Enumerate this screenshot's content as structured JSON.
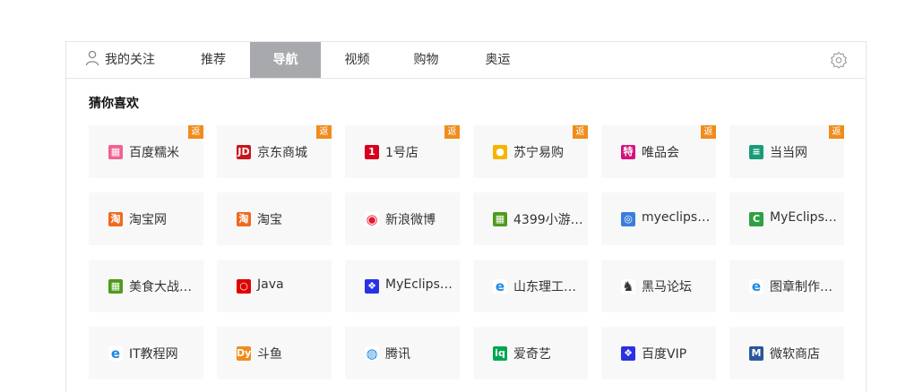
{
  "tabs": [
    {
      "label": "我的关注",
      "active": false
    },
    {
      "label": "推荐",
      "active": false
    },
    {
      "label": "导航",
      "active": true
    },
    {
      "label": "视频",
      "active": false
    },
    {
      "label": "购物",
      "active": false
    },
    {
      "label": "奥运",
      "active": false
    }
  ],
  "section_title": "猜你喜欢",
  "badge_label": "返",
  "colors": {
    "active_tab": "#a7a9ac",
    "badge": "#f08c1e",
    "tile_bg": "#f8f8f8"
  },
  "sites": [
    [
      {
        "label": "百度糯米",
        "icon": "nuomi-icon",
        "badge": true
      },
      {
        "label": "京东商城",
        "icon": "jd-icon",
        "badge": true
      },
      {
        "label": "1号店",
        "icon": "yhd-icon",
        "badge": true
      },
      {
        "label": "苏宁易购",
        "icon": "suning-icon",
        "badge": true
      },
      {
        "label": "唯品会",
        "icon": "vip-icon",
        "badge": true
      },
      {
        "label": "当当网",
        "icon": "dangdang-icon",
        "badge": true
      }
    ],
    [
      {
        "label": "淘宝网",
        "icon": "taobao-icon",
        "badge": false
      },
      {
        "label": "淘宝",
        "icon": "taobao-icon",
        "badge": false
      },
      {
        "label": "新浪微博",
        "icon": "weibo-icon",
        "badge": false
      },
      {
        "label": "4399小游…",
        "icon": "4399-icon",
        "badge": false
      },
      {
        "label": "myeclips…",
        "icon": "globe-icon",
        "badge": false
      },
      {
        "label": "MyEclips…",
        "icon": "chrome-icon",
        "badge": false
      }
    ],
    [
      {
        "label": "美食大战…",
        "icon": "game-icon",
        "badge": false
      },
      {
        "label": "Java",
        "icon": "oracle-icon",
        "badge": false
      },
      {
        "label": "MyEclips…",
        "icon": "baidu-paw-icon",
        "badge": false
      },
      {
        "label": "山东理工…",
        "icon": "ie-icon",
        "badge": false
      },
      {
        "label": "黑马论坛",
        "icon": "horse-icon",
        "badge": false
      },
      {
        "label": "图章制作…",
        "icon": "ie-icon",
        "badge": false
      }
    ],
    [
      {
        "label": "IT教程网",
        "icon": "ie-icon",
        "badge": false
      },
      {
        "label": "斗鱼",
        "icon": "douyu-icon",
        "badge": false
      },
      {
        "label": "腾讯",
        "icon": "tencent-icon",
        "badge": false
      },
      {
        "label": "爱奇艺",
        "icon": "iqiyi-icon",
        "badge": false
      },
      {
        "label": "百度VIP",
        "icon": "baidu-paw-icon",
        "badge": false
      },
      {
        "label": "微软商店",
        "icon": "ms-store-icon",
        "badge": false
      }
    ]
  ]
}
